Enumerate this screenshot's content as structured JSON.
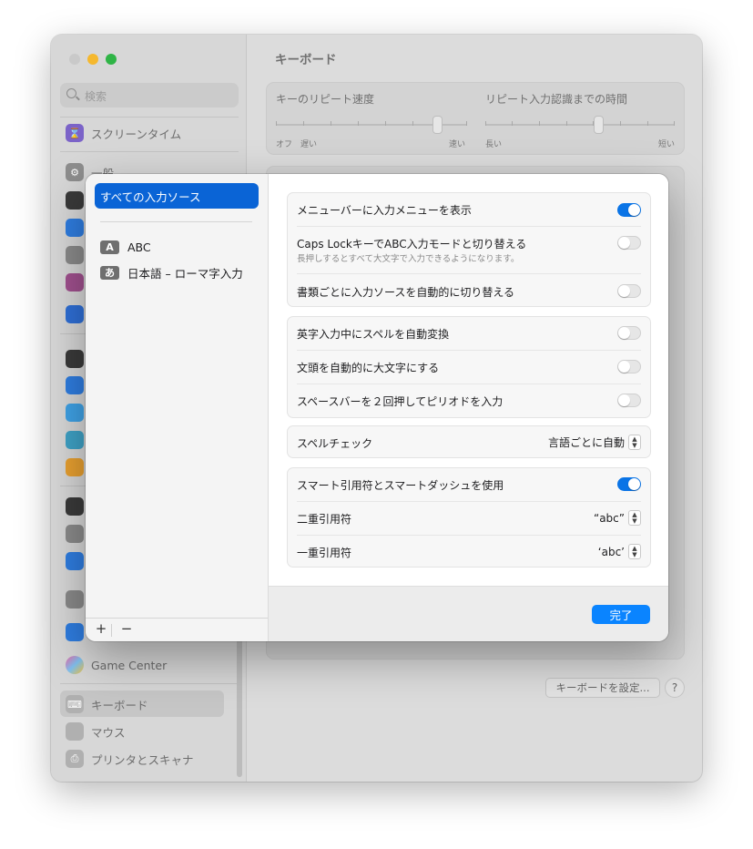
{
  "window": {
    "title": "キーボード"
  },
  "sidebar": {
    "search_placeholder": "検索",
    "items": [
      {
        "label": "スクリーンタイム",
        "icon": "hourglass-icon"
      },
      {
        "label": "一般",
        "icon": "gear-icon"
      },
      {
        "label": "Game Center",
        "icon": "game-center-icon"
      },
      {
        "label": "キーボード",
        "icon": "keyboard-icon"
      },
      {
        "label": "マウス",
        "icon": "mouse-icon"
      },
      {
        "label": "プリンタとスキャナ",
        "icon": "printer-icon"
      }
    ]
  },
  "main": {
    "key_repeat": {
      "label": "キーのリピート速度",
      "min": "オフ",
      "min2": "遅い",
      "max": "速い"
    },
    "delay": {
      "label": "リピート入力認識までの時間",
      "min": "長い",
      "max": "短い"
    },
    "keyboard_settings_button": "キーボードを設定...",
    "help": "?"
  },
  "sheet": {
    "sources": {
      "selected": "すべての入力ソース",
      "items": [
        {
          "badge": "A",
          "label": "ABC"
        },
        {
          "badge": "あ",
          "label": "日本語 – ローマ字入力"
        }
      ],
      "add": "+",
      "remove": "−"
    },
    "group1": {
      "show_menu": {
        "label": "メニューバーに入力メニューを表示",
        "on": true
      },
      "caps_lock": {
        "label": "Caps LockキーでABC入力モードと切り替える",
        "sub": "長押しするとすべて大文字で入力できるようになります。",
        "on": false
      },
      "auto_switch": {
        "label": "書類ごとに入力ソースを自動的に切り替える",
        "on": false
      }
    },
    "group2": {
      "auto_correct": {
        "label": "英字入力中にスペルを自動変換",
        "on": false
      },
      "auto_cap": {
        "label": "文頭を自動的に大文字にする",
        "on": false
      },
      "period": {
        "label": "スペースバーを２回押してピリオドを入力",
        "on": false
      }
    },
    "spell": {
      "label": "スペルチェック",
      "value": "言語ごとに自動"
    },
    "group4": {
      "smart_quotes": {
        "label": "スマート引用符とスマートダッシュを使用",
        "on": true
      },
      "double": {
        "label": "二重引用符",
        "value": "“abc”"
      },
      "single": {
        "label": "一重引用符",
        "value": "‘abc’"
      }
    },
    "done": "完了"
  },
  "colors": {
    "accent": "#0a84ff",
    "selection": "#0a64d6"
  }
}
